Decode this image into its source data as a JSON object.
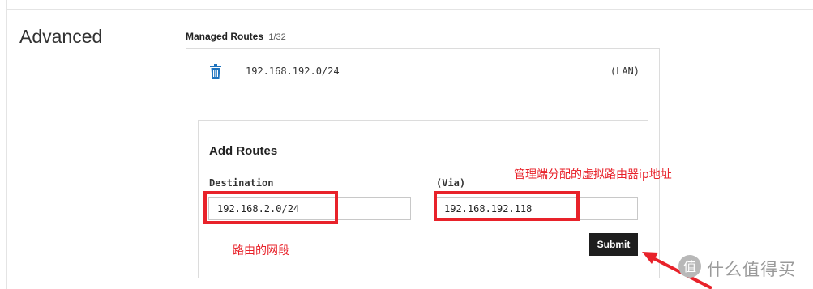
{
  "section": {
    "title": "Advanced"
  },
  "managed_routes": {
    "label": "Managed Routes",
    "count": "1/32",
    "items": [
      {
        "ip": "192.168.192.0/24",
        "tag": "(LAN)",
        "delete_icon": "trash-icon"
      }
    ]
  },
  "add_routes": {
    "title": "Add Routes",
    "destination_label": "Destination",
    "destination_value": "192.168.2.0/24",
    "via_label": "(Via)",
    "via_value": "192.168.192.118",
    "submit_label": "Submit"
  },
  "annotations": {
    "via_note": "管理端分配的虚拟路由器ip地址",
    "dest_note": "路由的网段",
    "color": "#e8222a"
  },
  "watermark": {
    "text": "值 什么值得买",
    "logo_icon": "smzdm-logo-icon"
  },
  "colors": {
    "accent_blue": "#1e73be",
    "annotation_red": "#e8222a",
    "submit_bg": "#1e1e1e"
  }
}
